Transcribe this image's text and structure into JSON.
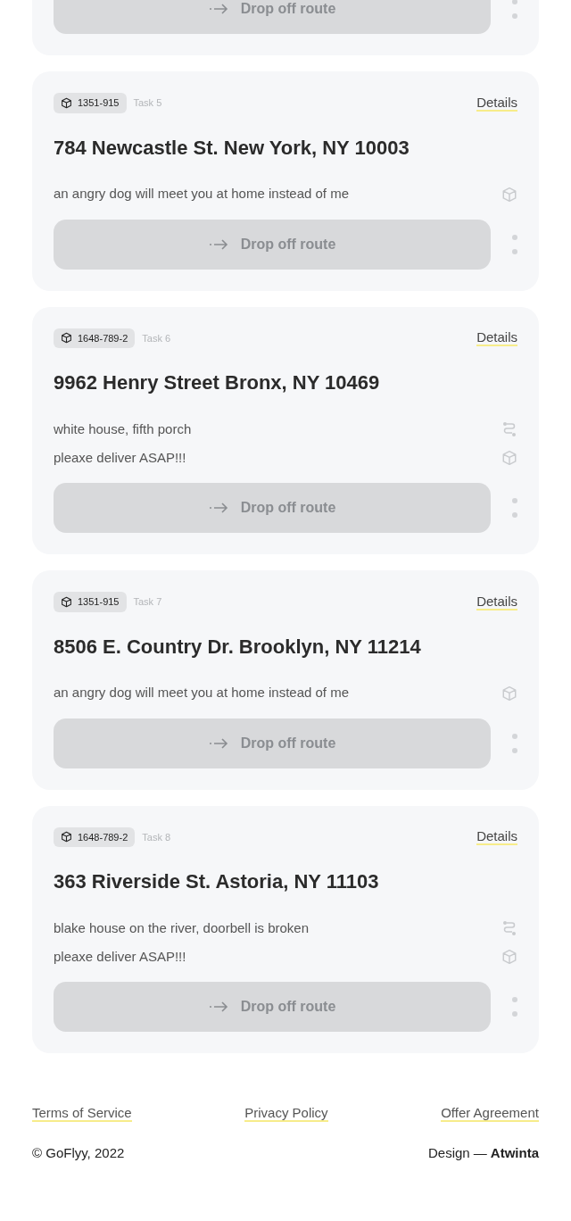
{
  "tasks": [
    {
      "button": "Drop off route"
    },
    {
      "tag": "1351-915",
      "task": "Task 5",
      "details": "Details",
      "address": "784 Newcastle St. New York, NY 10003",
      "notes": [
        {
          "text": "an angry dog will meet you at home instead of me",
          "kind": "package"
        }
      ],
      "button": "Drop off route"
    },
    {
      "tag": "1648-789-2",
      "task": "Task 6",
      "details": "Details",
      "address": "9962 Henry Street Bronx, NY 10469",
      "notes": [
        {
          "text": "white house, fifth porch",
          "kind": "route"
        },
        {
          "text": "pleaxe deliver ASAP!!!",
          "kind": "package"
        }
      ],
      "button": "Drop off route"
    },
    {
      "tag": "1351-915",
      "task": "Task 7",
      "details": "Details",
      "address": "8506 E. Country Dr. Brooklyn, NY 11214",
      "notes": [
        {
          "text": "an angry dog will meet you at home instead of me",
          "kind": "package"
        }
      ],
      "button": "Drop off route"
    },
    {
      "tag": "1648-789-2",
      "task": "Task 8",
      "details": "Details",
      "address": "363 Riverside St. Astoria, NY 11103",
      "notes": [
        {
          "text": "blake house on the river, doorbell is broken",
          "kind": "route"
        },
        {
          "text": "pleaxe deliver ASAP!!!",
          "kind": "package"
        }
      ],
      "button": "Drop off route"
    }
  ],
  "footer": {
    "links": [
      "Terms of Service",
      "Privacy Policy",
      "Offer Agreement"
    ],
    "copyright": "© GoFlyy, 2022",
    "design_label": "Design —",
    "designer": "Atwinta"
  }
}
